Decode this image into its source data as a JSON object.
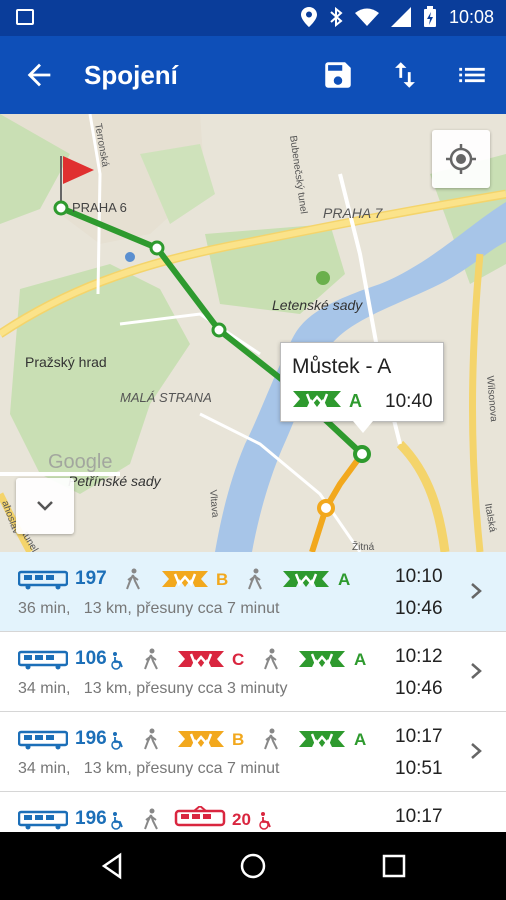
{
  "status": {
    "time": "10:08"
  },
  "appbar": {
    "title": "Spojení"
  },
  "map": {
    "labels": {
      "praha6": "PRAHA 6",
      "praha7": "PRAHA 7",
      "letenske": "Letenské sady",
      "hrad": "Pražský hrad",
      "mala": "MALÁ STRANA",
      "petrinske": "Petřínské sady",
      "google": "Google",
      "terronska": "Terronská",
      "bubenec": "Bubenečský tunel",
      "vitava": "Vltava",
      "wilsonova": "Wilsonova",
      "italska": "Italská",
      "zitna": "Žitná",
      "ahoslav": "ahoslav",
      "tunel": "tunel"
    },
    "popup": {
      "name": "Můstek - A",
      "line": "A",
      "time": "10:40"
    }
  },
  "connections": [
    {
      "bus": "197",
      "metro1": "B",
      "metro2": "A",
      "dep": "10:10",
      "arr": "10:46",
      "info": "36 min,   13 km, přesuny cca 7 minut"
    },
    {
      "bus": "106",
      "metro1": "C",
      "metro2": "A",
      "dep": "10:12",
      "arr": "10:46",
      "info": "34 min,   13 km, přesuny cca 3 minuty"
    },
    {
      "bus": "196",
      "metro1": "B",
      "metro2": "A",
      "dep": "10:17",
      "arr": "10:51",
      "info": "34 min,   13 km, přesuny cca 7 minut"
    },
    {
      "bus": "196",
      "tram": "20",
      "dep": "10:17"
    }
  ],
  "colors": {
    "appbar": "#0e4fb8",
    "statusbar": "#0a3d9a",
    "metroA": "#2e9a2e",
    "metroB": "#f2a81d",
    "metroC": "#d9263f",
    "bus": "#1c6fb8",
    "selected": "#e3f3fc"
  }
}
